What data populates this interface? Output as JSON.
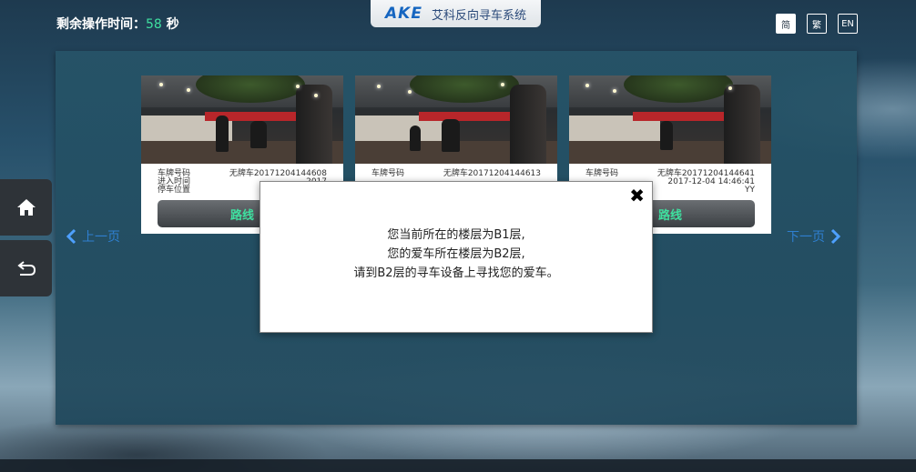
{
  "header": {
    "timer_label": "剩余操作时间：",
    "timer_value": "58",
    "timer_unit": "秒",
    "brand_logo": "AKE",
    "brand_title": "艾科反向寻车系统",
    "languages": [
      "简",
      "繁",
      "EN"
    ]
  },
  "nav": {
    "prev_label": "上一页",
    "next_label": "下一页",
    "home_icon": "home-icon",
    "back_icon": "return-icon"
  },
  "cards": [
    {
      "label_plate": "车牌号码",
      "label_time": "进入时间",
      "label_location": "停车位置",
      "plate": "无牌车20171204144608",
      "time": "2017",
      "location": "",
      "route_label": "路线"
    },
    {
      "label_plate": "车牌号码",
      "label_time": "",
      "label_location": "",
      "plate": "无牌车20171204144613",
      "time": "",
      "location": "",
      "route_label": ""
    },
    {
      "label_plate": "车牌号码",
      "label_time": "",
      "label_location": "",
      "plate": "无牌车20171204144641",
      "time": "2017-12-04 14:46:41",
      "location": "YY",
      "route_label": "路线"
    }
  ],
  "dialog": {
    "line1": "您当前所在的楼层为B1层,",
    "line2": "您的爱车所在楼层为B2层,",
    "line3": "请到B2层的寻车设备上寻找您的爱车。",
    "close_icon": "close-icon"
  },
  "colors": {
    "accent_green": "#3fe0a0",
    "nav_blue": "#2f7fd0",
    "brand_blue": "#1565c0"
  }
}
